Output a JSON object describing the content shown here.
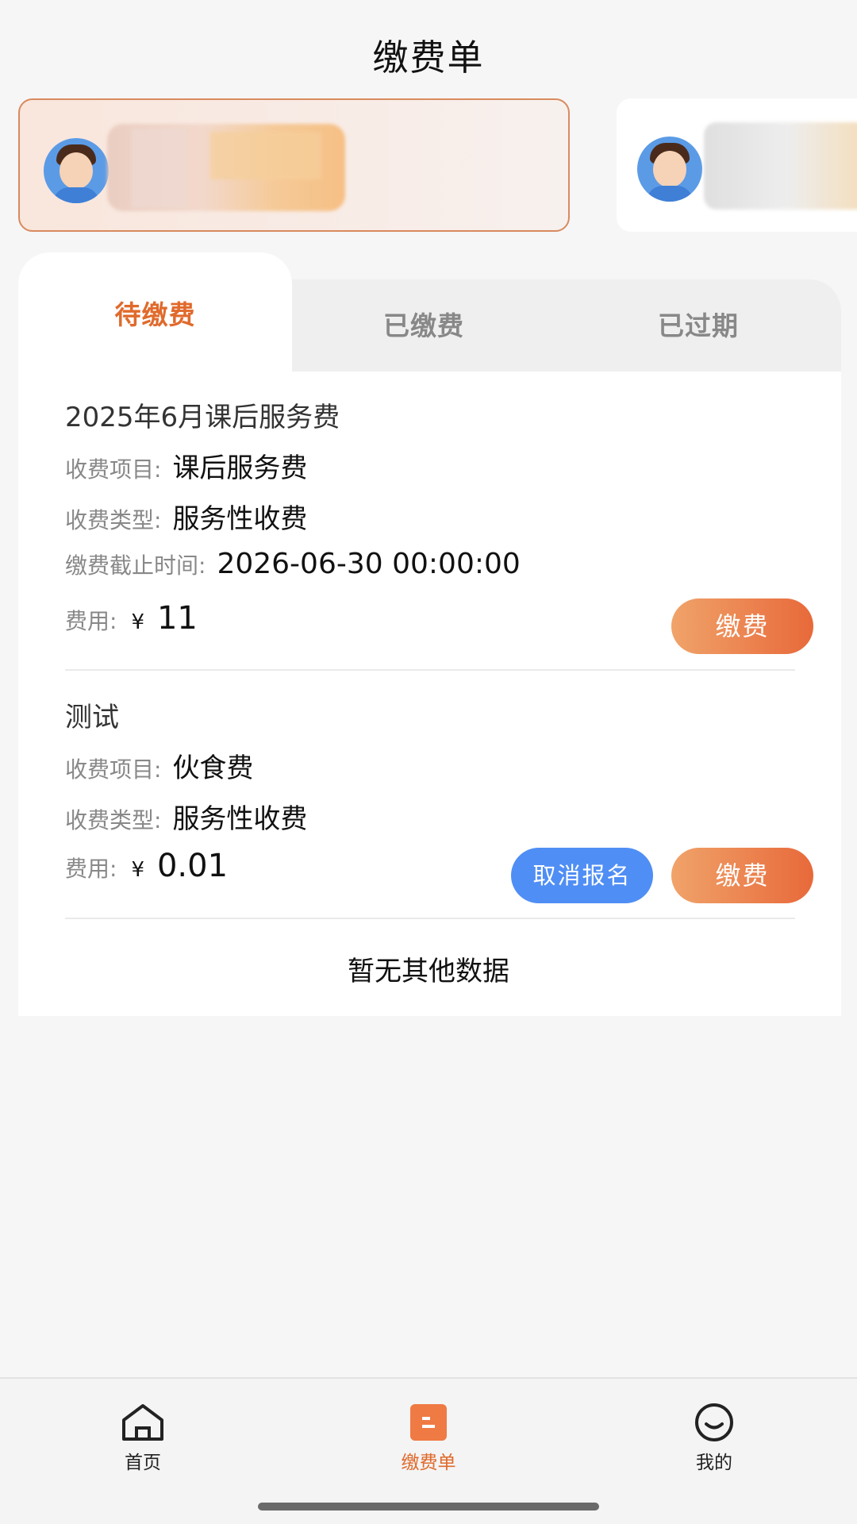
{
  "header": {
    "title": "缴费单"
  },
  "students": [
    {
      "name_hidden": true,
      "selected": true
    },
    {
      "name_hidden": true,
      "selected": false
    }
  ],
  "tabs": [
    {
      "label": "待缴费",
      "active": true
    },
    {
      "label": "已缴费",
      "active": false
    },
    {
      "label": "已过期",
      "active": false
    }
  ],
  "bills": [
    {
      "title": "2025年6月课后服务费",
      "item_label": "收费项目:",
      "item_value": "课后服务费",
      "type_label": "收费类型:",
      "type_value": "服务性收费",
      "deadline_label": "缴费截止时间:",
      "deadline_value": "2026-06-30 00:00:00",
      "price_label": "费用:",
      "currency": "¥",
      "amount": "11",
      "pay_label": "缴费"
    },
    {
      "title": "测试",
      "item_label": "收费项目:",
      "item_value": "伙食费",
      "type_label": "收费类型:",
      "type_value": "服务性收费",
      "price_label": "费用:",
      "currency": "¥",
      "amount": "0.01",
      "cancel_label": "取消报名",
      "pay_label": "缴费"
    }
  ],
  "empty_text": "暂无其他数据",
  "nav": [
    {
      "label": "首页",
      "icon": "home-icon",
      "active": false
    },
    {
      "label": "缴费单",
      "icon": "bill-icon",
      "active": true
    },
    {
      "label": "我的",
      "icon": "smile-icon",
      "active": false
    }
  ],
  "colors": {
    "accent": "#e06a2c",
    "pay_gradient_start": "#f0a36a",
    "pay_gradient_end": "#e8693a",
    "cancel_blue": "#4f8ef4",
    "background": "#f6f6f6"
  }
}
